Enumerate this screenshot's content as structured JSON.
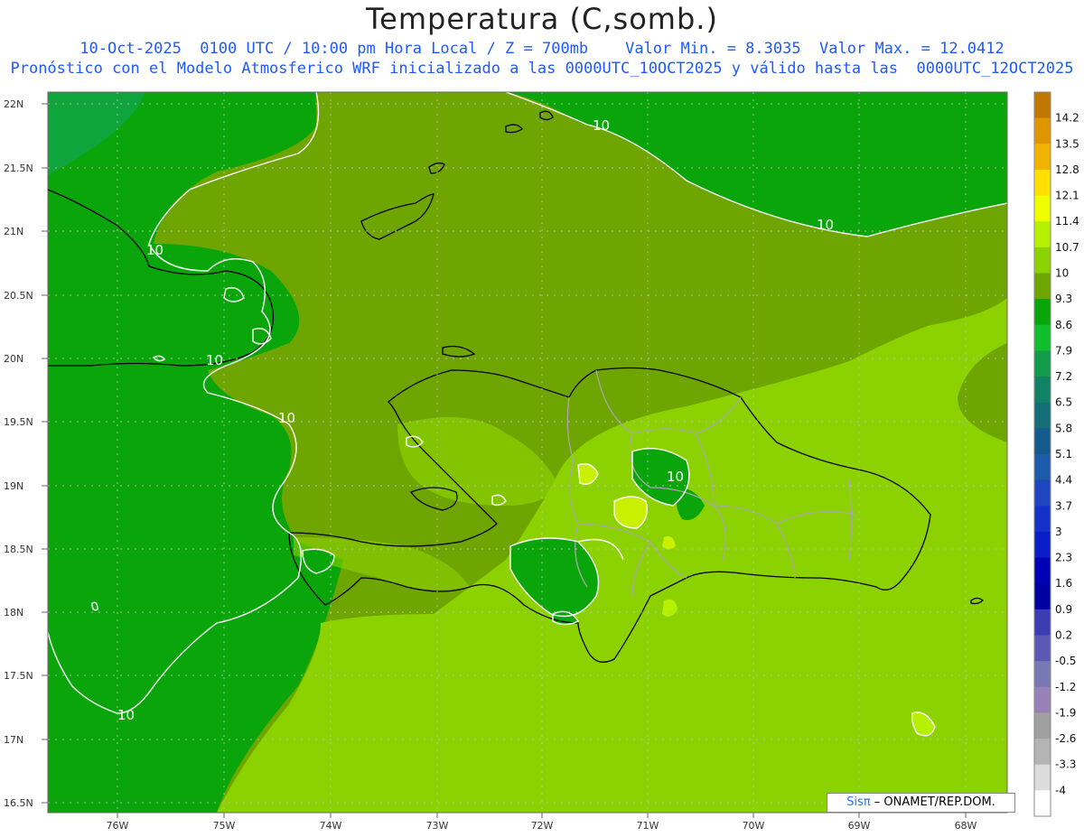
{
  "header": {
    "title": "Temperatura (C,somb.)",
    "line1": "10-Oct-2025  0100 UTC / 10:00 pm Hora Local / Z = 700mb    Valor Min. = 8.3035  Valor Max. = 12.0412",
    "line2": "Pronóstico con el Modelo Atmosferico WRF inicializado a las 0000UTC_10OCT2025 y válido hasta las  0000UTC_12OCT2025"
  },
  "axes": {
    "lat_labels": [
      "22N",
      "21.5N",
      "21N",
      "20.5N",
      "20N",
      "19.5N",
      "19N",
      "18.5N",
      "18N",
      "17.5N",
      "17N",
      "16.5N"
    ],
    "lon_labels": [
      "76W",
      "75W",
      "74W",
      "73W",
      "72W",
      "71W",
      "70W",
      "69W",
      "68W"
    ]
  },
  "contour_labels": [
    "10",
    "10",
    "10",
    "10",
    "10",
    "10",
    "10"
  ],
  "colorbar": {
    "labels": [
      "14.2",
      "13.5",
      "12.8",
      "12.1",
      "11.4",
      "10.7",
      "10",
      "9.3",
      "8.6",
      "7.9",
      "7.2",
      "6.5",
      "5.8",
      "5.1",
      "4.4",
      "3.7",
      "3",
      "2.3",
      "1.6",
      "0.9",
      "0.2",
      "-0.5",
      "-1.2",
      "-1.9",
      "-2.6",
      "-3.3",
      "-4"
    ],
    "colors": [
      "#c07800",
      "#e09600",
      "#f0b400",
      "#ffe000",
      "#f0ff00",
      "#b4f000",
      "#8cd200",
      "#6ea500",
      "#0aa50a",
      "#0fbe2d",
      "#129b4b",
      "#128264",
      "#146e78",
      "#145a8c",
      "#1e5aaa",
      "#1e46be",
      "#1432c8",
      "#0a1ec8",
      "#0000b4",
      "#0000a0",
      "#3c3cb4",
      "#5a5ab4",
      "#7878b4",
      "#9682b4",
      "#a0a0a0",
      "#b4b4b4",
      "#dcdcdc",
      "#ffffff"
    ]
  },
  "credit": {
    "logo": "Sisπ",
    "text": " – ONAMET/REP.DOM."
  }
}
